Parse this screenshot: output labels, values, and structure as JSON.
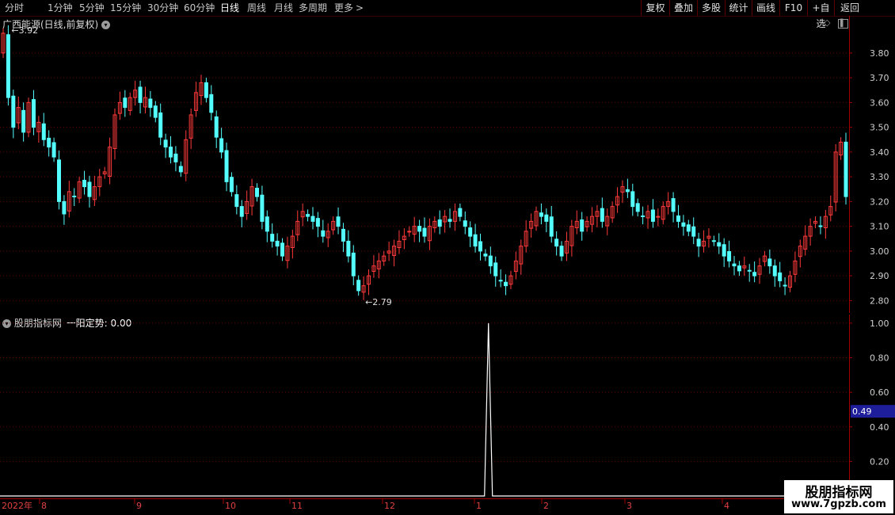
{
  "toolbar": {
    "timeframes": [
      "分时",
      "1分钟",
      "5分钟",
      "15分钟",
      "30分钟",
      "60分钟",
      "日线",
      "周线",
      "月线",
      "多周期",
      "更多"
    ],
    "active_timeframe": "日线",
    "right_buttons": [
      "复权",
      "叠加",
      "多股",
      "统计",
      "画线",
      "F10",
      "+自选",
      "返回"
    ],
    "more_arrow": ">"
  },
  "main": {
    "title": "广西能源(日线,前复权)",
    "high_marker": "3.92",
    "low_marker": "2.79",
    "yticks": [
      "3.80",
      "3.70",
      "3.60",
      "3.50",
      "3.40",
      "3.30",
      "3.20",
      "3.10",
      "3.00",
      "2.90",
      "2.80"
    ]
  },
  "indicator": {
    "title": "股朋指标网",
    "line_label": "一阳定势: 0.00",
    "yticks": [
      "1.00",
      "0.80",
      "0.60",
      "0.40",
      "0.20"
    ],
    "cursor_value": "0.49"
  },
  "xaxis": {
    "labels": [
      "2022年",
      "8",
      "9",
      "10",
      "11",
      "12",
      "1",
      "2",
      "3",
      "4"
    ]
  },
  "watermark": {
    "line1": "股朋指标网",
    "line2": "www.7gpzb.com"
  },
  "colors": {
    "up": "#ff3a3a",
    "down": "#54ffff",
    "grid": "#6a0000",
    "axis": "#a00000",
    "signal": "#ffffff",
    "cursor_bg": "#1e1e9a"
  },
  "chart_data": [
    {
      "type": "candlestick",
      "title": "广西能源(日线,前复权)",
      "ylim": [
        2.75,
        3.95
      ],
      "x_months": [
        "8",
        "9",
        "10",
        "11",
        "12",
        "1",
        "2",
        "3",
        "4"
      ],
      "close": [
        3.88,
        3.62,
        3.5,
        3.58,
        3.48,
        3.6,
        3.5,
        3.52,
        3.45,
        3.42,
        3.38,
        3.2,
        3.15,
        3.24,
        3.22,
        3.28,
        3.26,
        3.22,
        3.26,
        3.3,
        3.32,
        3.42,
        3.55,
        3.6,
        3.58,
        3.62,
        3.65,
        3.6,
        3.62,
        3.58,
        3.54,
        3.46,
        3.42,
        3.38,
        3.36,
        3.32,
        3.45,
        3.55,
        3.64,
        3.68,
        3.62,
        3.56,
        3.46,
        3.4,
        3.28,
        3.24,
        3.18,
        3.14,
        3.2,
        3.26,
        3.22,
        3.12,
        3.08,
        3.04,
        3.02,
        2.98,
        3.02,
        3.06,
        3.12,
        3.16,
        3.14,
        3.12,
        3.1,
        3.06,
        3.08,
        3.12,
        3.1,
        3.04,
        2.98,
        2.9,
        2.84,
        2.86,
        2.9,
        2.94,
        2.96,
        2.98,
        3.0,
        3.02,
        3.04,
        3.06,
        3.08,
        3.1,
        3.08,
        3.06,
        3.1,
        3.12,
        3.1,
        3.14,
        3.12,
        3.16,
        3.14,
        3.1,
        3.06,
        3.02,
        3.0,
        2.98,
        2.94,
        2.9,
        2.88,
        2.86,
        2.9,
        2.96,
        3.02,
        3.08,
        3.12,
        3.16,
        3.14,
        3.12,
        3.06,
        3.02,
        2.98,
        3.04,
        3.1,
        3.12,
        3.08,
        3.12,
        3.14,
        3.16,
        3.12,
        3.14,
        3.18,
        3.22,
        3.26,
        3.24,
        3.18,
        3.16,
        3.14,
        3.16,
        3.12,
        3.14,
        3.18,
        3.2,
        3.16,
        3.12,
        3.1,
        3.08,
        3.06,
        3.02,
        3.04,
        3.06,
        3.04,
        3.02,
        2.98,
        2.96,
        2.94,
        2.92,
        2.94,
        2.92,
        2.9,
        2.94,
        2.98,
        2.94,
        2.9,
        2.88,
        2.86,
        2.9,
        2.96,
        3.02,
        3.06,
        3.1,
        3.12,
        3.1,
        3.14,
        3.18,
        3.4,
        3.44,
        3.22
      ]
    },
    {
      "type": "line",
      "name": "一阳定势",
      "ylim": [
        0,
        1.05
      ],
      "spike_at_fraction": 0.5753,
      "spike_value": 1.0,
      "baseline": 0.0
    }
  ]
}
